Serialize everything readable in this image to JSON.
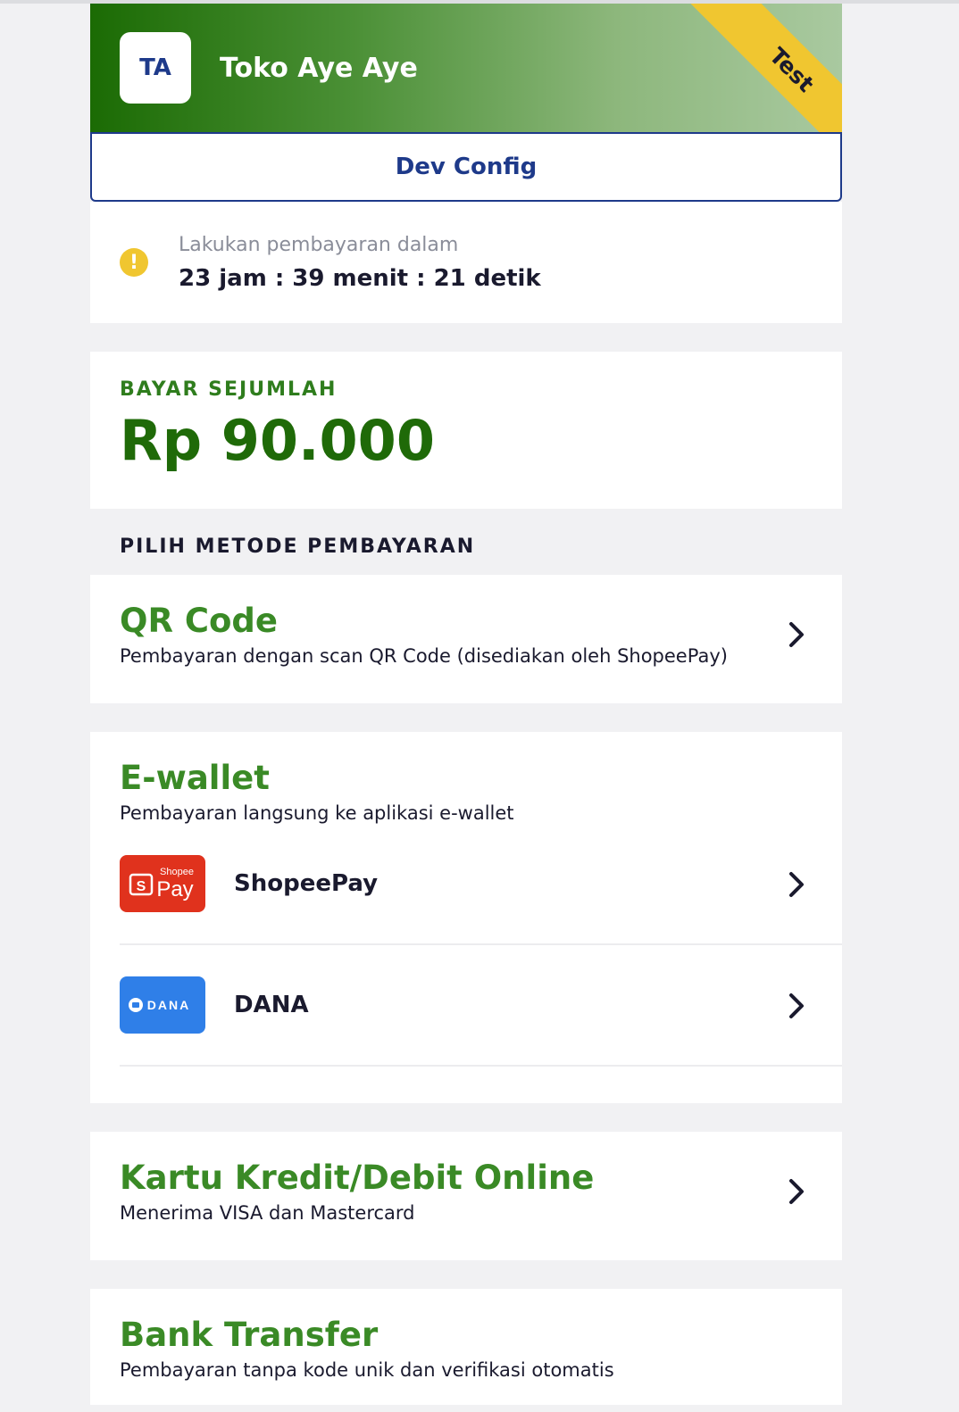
{
  "header": {
    "avatar_initials": "TA",
    "store_name": "Toko Aye Aye",
    "ribbon": "Test",
    "gradient_start": "#1b6b04",
    "gradient_end": "#a9c9a0"
  },
  "dev_config": {
    "label": "Dev Config"
  },
  "timer": {
    "label": "Lakukan pembayaran dalam",
    "value": "23 jam : 39 menit : 21 detik",
    "icon": "warning-icon"
  },
  "amount": {
    "label": "BAYAR SEJUMLAH",
    "value": "Rp 90.000"
  },
  "payment": {
    "section_title": "PILIH METODE PEMBAYARAN",
    "qr": {
      "title": "QR Code",
      "desc": "Pembayaran dengan scan QR Code (disediakan oleh ShopeePay)"
    },
    "ewallet": {
      "title": "E-wallet",
      "desc": "Pembayaran langsung ke aplikasi e-wallet",
      "items": [
        {
          "name": "ShopeePay",
          "logo_top": "Shopee",
          "logo_main": "Pay",
          "color": "#e0321d"
        },
        {
          "name": "DANA",
          "logo_main": "DANA",
          "color": "#2f7fe8"
        }
      ]
    },
    "card": {
      "title": "Kartu Kredit/Debit Online",
      "desc": "Menerima VISA dan Mastercard"
    },
    "bank": {
      "title": "Bank Transfer",
      "desc": "Pembayaran tanpa kode unik dan verifikasi otomatis"
    }
  },
  "colors": {
    "accent_green": "#3a8a26",
    "dark_green": "#1f6a08",
    "navy": "#1e3a8a",
    "ribbon_yellow": "#f0c630"
  }
}
